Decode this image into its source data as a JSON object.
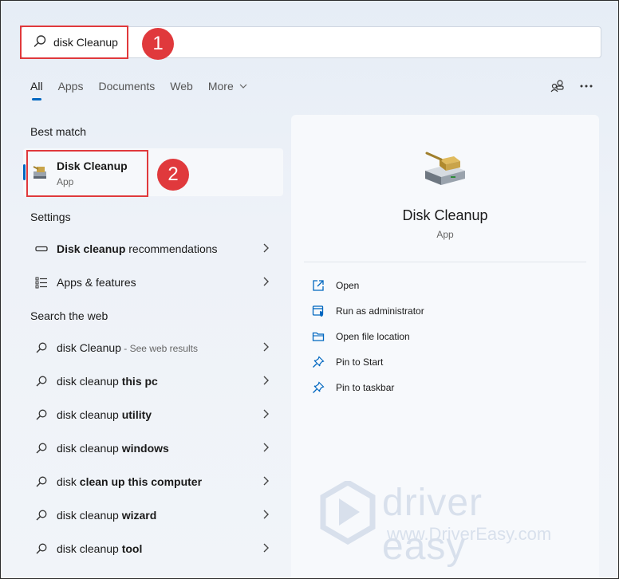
{
  "search": {
    "value": "disk Cleanup"
  },
  "callouts": [
    "1",
    "2"
  ],
  "tabs": [
    {
      "label": "All"
    },
    {
      "label": "Apps"
    },
    {
      "label": "Documents"
    },
    {
      "label": "Web"
    },
    {
      "label": "More"
    }
  ],
  "toolbar": {
    "share_icon": "people-icon",
    "more_icon": "ellipsis-icon"
  },
  "sections": {
    "best_match": "Best match",
    "settings": "Settings",
    "search_web": "Search the web"
  },
  "best_match": {
    "title": "Disk Cleanup",
    "subtitle": "App"
  },
  "settings_items": [
    {
      "bold": "Disk cleanup",
      "rest": " recommendations"
    },
    {
      "bold": "",
      "rest": "Apps & features"
    }
  ],
  "web_items": [
    {
      "plain": "disk Cleanup",
      "bold": "",
      "suffix": " - See web results"
    },
    {
      "plain": "disk cleanup ",
      "bold": "this pc",
      "suffix": ""
    },
    {
      "plain": "disk cleanup ",
      "bold": "utility",
      "suffix": ""
    },
    {
      "plain": "disk cleanup ",
      "bold": "windows",
      "suffix": ""
    },
    {
      "plain": "disk ",
      "bold": "clean up this computer",
      "suffix": ""
    },
    {
      "plain": "disk cleanup ",
      "bold": "wizard",
      "suffix": ""
    },
    {
      "plain": "disk cleanup ",
      "bold": "tool",
      "suffix": ""
    }
  ],
  "panel": {
    "title": "Disk Cleanup",
    "subtitle": "App",
    "actions": [
      {
        "label": "Open",
        "icon": "open-external-icon"
      },
      {
        "label": "Run as administrator",
        "icon": "shield-window-icon"
      },
      {
        "label": "Open file location",
        "icon": "folder-icon"
      },
      {
        "label": "Pin to Start",
        "icon": "pin-icon"
      },
      {
        "label": "Pin to taskbar",
        "icon": "pin-icon"
      }
    ]
  },
  "watermark": {
    "brand": "driver easy",
    "url": "www.DriverEasy.com"
  },
  "colors": {
    "accent": "#0067c0",
    "callout": "#e0393c"
  }
}
